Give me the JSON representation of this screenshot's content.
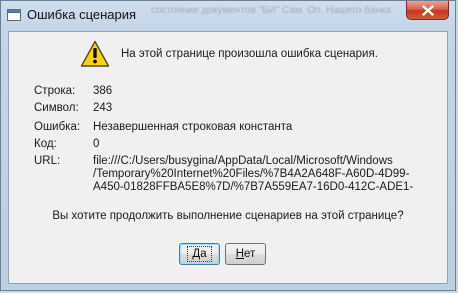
{
  "window": {
    "title": "Ошибка сценария",
    "background_title": "состояние документов \"БИ\" Сам. Оп. Нашего банка"
  },
  "message": {
    "headline": "На этой странице произошла ошибка сценария."
  },
  "details": {
    "line_label": "Строка:",
    "line_value": "386",
    "char_label": "Символ:",
    "char_value": "243",
    "error_label": "Ошибка:",
    "error_value": "Незавершенная строковая константа",
    "code_label": "Код:",
    "code_value": "0",
    "url_label": "URL:",
    "url_lines": [
      "file:///C:/Users/busygina/AppData/Local/Microsoft/Windows",
      "/Temporary%20Internet%20Files/%7B4A2A648F-A60D-4D99-",
      "A450-01828FFBA5E8%7D/%7B7A559EA7-16D0-412C-ADE1-"
    ]
  },
  "question": "Вы хотите продолжить выполнение сценариев на этой странице?",
  "buttons": {
    "yes_first": "Д",
    "yes_rest": "а",
    "no_first": "Н",
    "no_rest": "ет"
  },
  "colors": {
    "warning_yellow": "#f7d21c",
    "close_red": "#c13a1e",
    "default_button_border": "#3c7fb1"
  }
}
